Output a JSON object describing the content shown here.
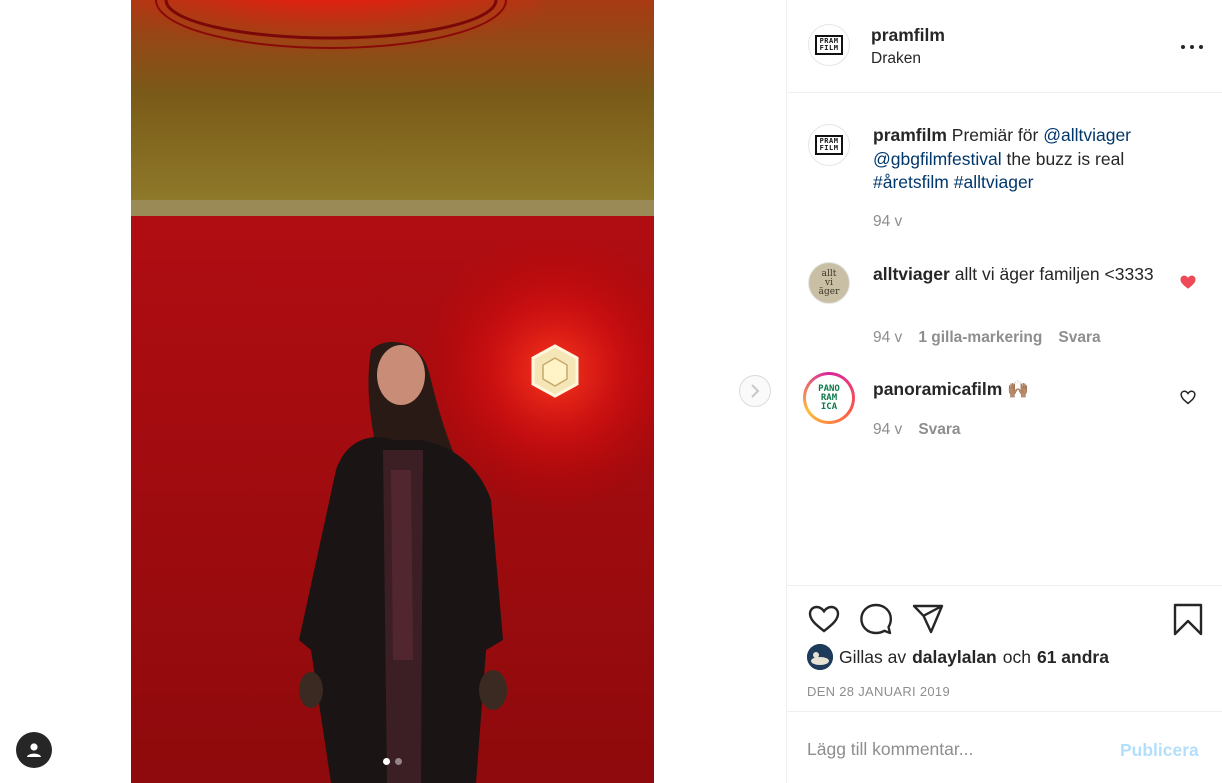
{
  "post": {
    "username": "pramfilm",
    "location": "Draken",
    "avatar_text": "PRAM FILM",
    "carousel": {
      "count": 2,
      "active": 1
    }
  },
  "caption": {
    "username": "pramfilm",
    "text": "Premiär för",
    "mention1": "@alltviager",
    "mention2": "@gbgfilmfestival",
    "text2": "the buzz is real",
    "hashtag1": "#åretsfilm",
    "hashtag2": "#alltviager",
    "age": "94 v"
  },
  "comments": [
    {
      "username": "alltviager",
      "text": "allt vi äger familjen <3333",
      "age": "94 v",
      "likes": "1 gilla-markering",
      "reply": "Svara",
      "liked": true,
      "avatar_text": "allt vi äger"
    },
    {
      "username": "panoramicafilm",
      "text": "🙌🏽",
      "age": "94 v",
      "reply": "Svara",
      "liked": false,
      "avatar_text": "PANO RAM ICA"
    }
  ],
  "likes": {
    "prefix": "Gillas av",
    "user": "dalaylalan",
    "joiner": "och",
    "others": "61 andra"
  },
  "date": "DEN 28 JANUARI 2019",
  "comment_box": {
    "placeholder": "Lägg till kommentar...",
    "publish_label": "Publicera"
  },
  "colors": {
    "link": "#00376b",
    "like_red": "#ed4956",
    "publish_disabled": "#b2dffc",
    "muted": "#8e8e8e"
  },
  "icons": [
    "chevron-right-icon",
    "more-icon",
    "heart-icon",
    "comment-icon",
    "share-icon",
    "bookmark-icon",
    "user-icon"
  ]
}
